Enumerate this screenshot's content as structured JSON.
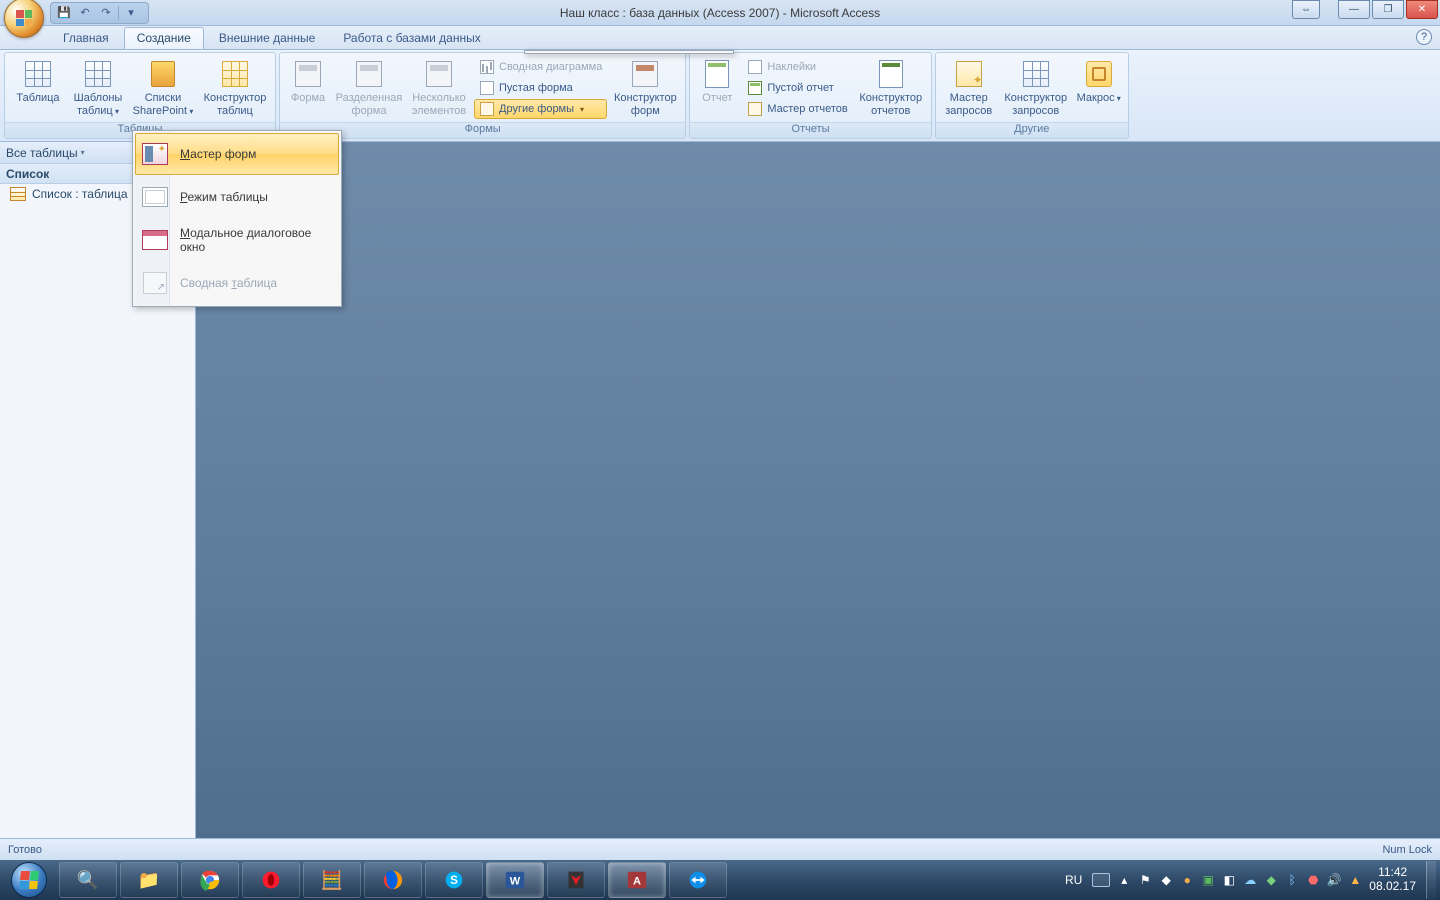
{
  "title": "Наш класс : база данных (Access 2007) - Microsoft Access",
  "tabs": {
    "home": "Главная",
    "create": "Создание",
    "external": "Внешние данные",
    "dbtools": "Работа с базами данных"
  },
  "ribbon": {
    "groups": {
      "tables": "Таблицы",
      "forms": "Формы",
      "reports": "Отчеты",
      "other": "Другие"
    },
    "tables": {
      "table": "Таблица",
      "templates": "Шаблоны таблиц",
      "sharepoint": "Списки SharePoint",
      "designer": "Конструктор таблиц"
    },
    "forms": {
      "form": "Форма",
      "split": "Разделенная форма",
      "multi": "Несколько элементов",
      "pivotchart": "Сводная диаграмма",
      "blank": "Пустая форма",
      "more": "Другие формы",
      "designer": "Конструктор форм"
    },
    "reports": {
      "report": "Отчет",
      "labels": "Наклейки",
      "blank": "Пустой отчет",
      "wizard": "Мастер отчетов",
      "designer": "Конструктор отчетов"
    },
    "other": {
      "query_wizard": "Мастер запросов",
      "query_designer": "Конструктор запросов",
      "macro": "Макрос"
    }
  },
  "dropdown": {
    "form_wizard": "Мастер форм",
    "datasheet": "Режим таблицы",
    "modal": "Модальное диалоговое окно",
    "pivot": "Сводная таблица"
  },
  "navpane": {
    "header": "Все таблицы",
    "group": "Список",
    "item1": "Список : таблица"
  },
  "statusbar": {
    "left": "Готово",
    "right": "Num Lock"
  },
  "taskbar": {
    "lang": "RU",
    "time": "11:42",
    "date": "08.02.17"
  }
}
